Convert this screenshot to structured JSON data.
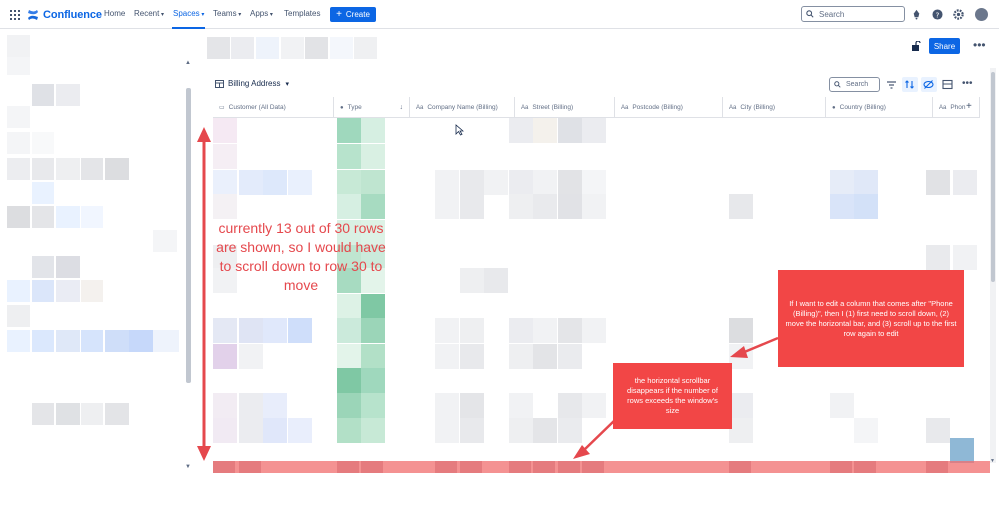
{
  "nav": {
    "logo": "Confluence",
    "home": "Home",
    "recent": "Recent",
    "spaces": "Spaces",
    "teams": "Teams",
    "apps": "Apps",
    "templates": "Templates",
    "create": "Create",
    "search_placeholder": "Search"
  },
  "page": {
    "share": "Share"
  },
  "table": {
    "view_name": "Billing Address",
    "search_placeholder": "Search",
    "columns": [
      {
        "label": "Customer (All Data)",
        "icon": "table-icon"
      },
      {
        "label": "Type",
        "icon": "status-icon"
      },
      {
        "label": "Company Name (Billing)",
        "icon": "text-icon"
      },
      {
        "label": "Street (Billing)",
        "icon": "text-icon"
      },
      {
        "label": "Postcode (Billing)",
        "icon": "text-icon"
      },
      {
        "label": "City (Billing)",
        "icon": "text-icon"
      },
      {
        "label": "Country (Billing)",
        "icon": "status-icon"
      },
      {
        "label": "Phon",
        "icon": "text-icon"
      }
    ]
  },
  "annotations": {
    "rows_note": "currently 13 out of 30 rows are shown, so I would have to scroll down to row 30 to move",
    "edit_note": "If I want to edit a column that comes after \"Phone (Billing)\", then I (1) first need to scroll down, (2) move the horizontal bar, and (3) scroll up to the first row again to edit",
    "scrollbar_note": "the horizontal scrollbar disappears if the number of rows exceeds the window's size"
  },
  "colors": {
    "brand": "#0c66e4",
    "annotation_red": "#f24646",
    "type_green": "#8fcfb1"
  }
}
